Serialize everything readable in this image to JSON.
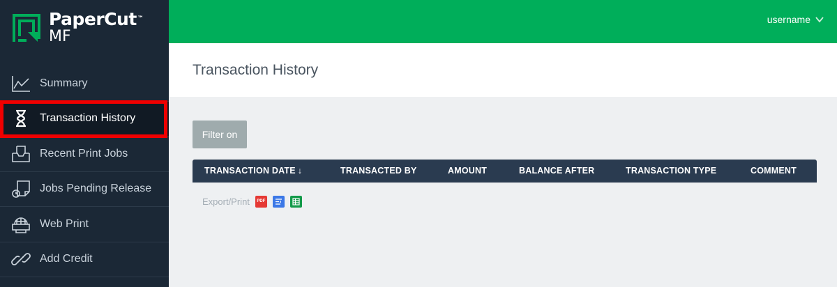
{
  "brand": {
    "name": "PaperCut",
    "trademark": "™",
    "product": "MF",
    "colors": {
      "accent_green": "#00ae5a",
      "sidebar": "#1b2836",
      "header_row": "#2a3b50"
    }
  },
  "topbar": {
    "username": "username",
    "chevron_icon": "chevron-down-icon"
  },
  "sidebar": {
    "items": [
      {
        "label": "Summary",
        "icon": "line-chart-icon"
      },
      {
        "label": "Transaction History",
        "icon": "hourglass-icon",
        "active": true
      },
      {
        "label": "Recent Print Jobs",
        "icon": "print-tray-icon"
      },
      {
        "label": "Jobs Pending Release",
        "icon": "pending-release-icon"
      },
      {
        "label": "Web Print",
        "icon": "globe-printer-icon"
      },
      {
        "label": "Add Credit",
        "icon": "link-icon"
      }
    ]
  },
  "page": {
    "title": "Transaction History"
  },
  "filter": {
    "button_label": "Filter on"
  },
  "table": {
    "columns": [
      {
        "label": "TRANSACTION DATE",
        "sort": "↓"
      },
      {
        "label": "TRANSACTED BY"
      },
      {
        "label": "AMOUNT"
      },
      {
        "label": "BALANCE AFTER"
      },
      {
        "label": "TRANSACTION TYPE"
      },
      {
        "label": "COMMENT"
      }
    ]
  },
  "export": {
    "label": "Export/Print",
    "pdf_label": "PDF",
    "icons": [
      "pdf-icon",
      "list-icon",
      "spreadsheet-icon"
    ]
  }
}
